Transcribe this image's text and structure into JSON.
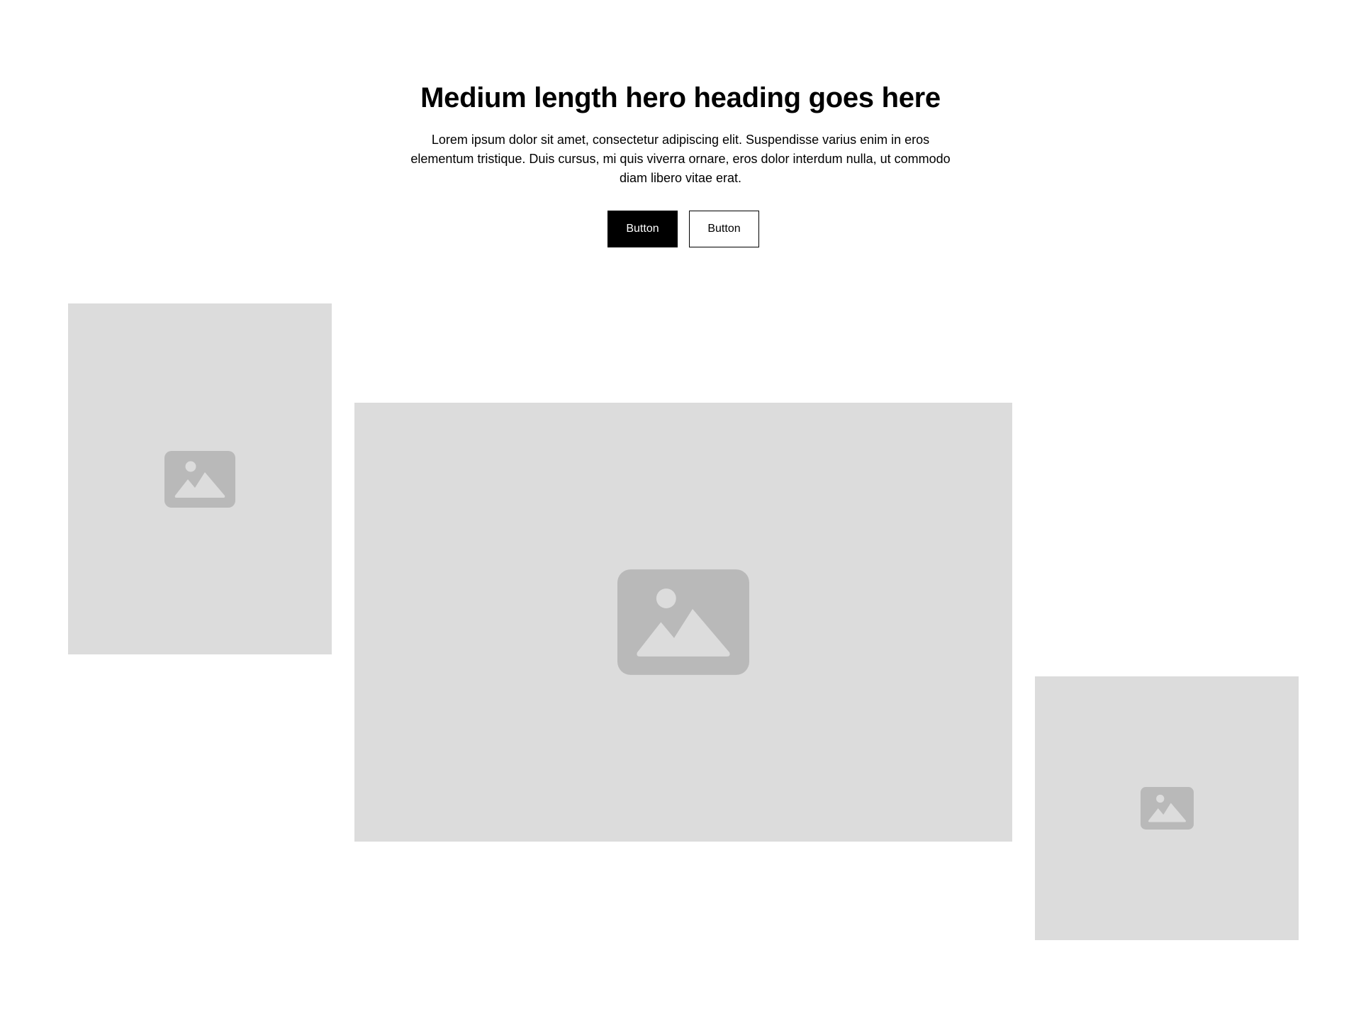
{
  "hero": {
    "heading": "Medium length hero heading goes here",
    "text": "Lorem ipsum dolor sit amet, consectetur adipiscing elit. Suspendisse varius enim in eros elementum tristique. Duis cursus, mi quis viverra ornare, eros dolor interdum nulla, ut commodo diam libero vitae erat.",
    "primary_button": "Button",
    "secondary_button": "Button"
  },
  "images": [
    {
      "icon": "image-placeholder-icon"
    },
    {
      "icon": "image-placeholder-icon"
    },
    {
      "icon": "image-placeholder-icon"
    }
  ],
  "colors": {
    "placeholder_bg": "#dcdcdc",
    "placeholder_icon": "#b9b9b9",
    "primary": "#000000",
    "background": "#ffffff"
  }
}
